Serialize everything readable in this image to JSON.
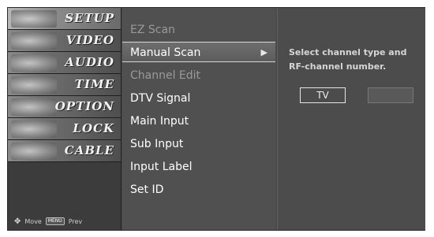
{
  "tabs": [
    {
      "label": "SETUP",
      "active": true
    },
    {
      "label": "VIDEO",
      "active": false
    },
    {
      "label": "AUDIO",
      "active": false
    },
    {
      "label": "TIME",
      "active": false
    },
    {
      "label": "OPTION",
      "active": false
    },
    {
      "label": "LOCK",
      "active": false
    },
    {
      "label": "CABLE",
      "active": false
    }
  ],
  "legend": {
    "move_icon": "move-arrows-icon",
    "move_label": "Move",
    "prev_key": "MENU",
    "prev_label": "Prev"
  },
  "menu": [
    {
      "label": "EZ Scan",
      "state": "dim"
    },
    {
      "label": "Manual Scan",
      "state": "selected",
      "arrow": "▶"
    },
    {
      "label": "Channel Edit",
      "state": "dim"
    },
    {
      "label": "DTV Signal",
      "state": "normal"
    },
    {
      "label": "Main Input",
      "state": "normal"
    },
    {
      "label": "Sub Input",
      "state": "normal"
    },
    {
      "label": "Input Label",
      "state": "normal"
    },
    {
      "label": "Set ID",
      "state": "normal"
    }
  ],
  "panel": {
    "info_text": "Select channel type and RF-channel number.",
    "buttons": [
      "TV",
      ""
    ]
  }
}
